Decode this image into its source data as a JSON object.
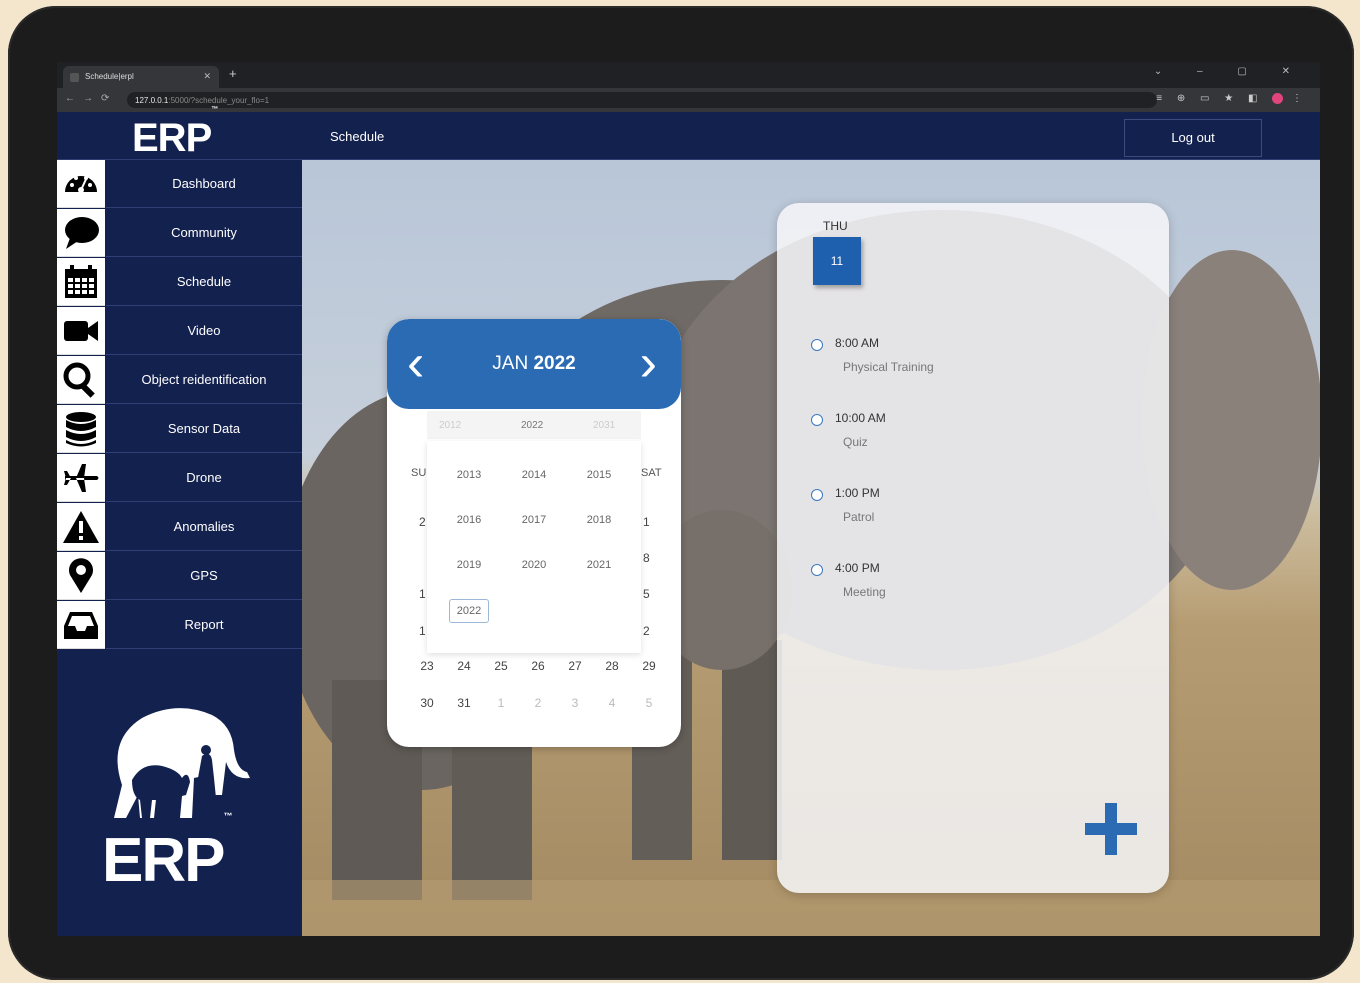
{
  "browser": {
    "tab_title": "Schedule|erpl",
    "url_host": "127.0.0.1",
    "url_rest": ":5000/?schedule_your_flo=1"
  },
  "header": {
    "logo": "ERP",
    "logo_tm": "™",
    "title": "Schedule",
    "logout_label": "Log out"
  },
  "sidebar": {
    "items": [
      {
        "label": "Dashboard",
        "icon": "dashboard-icon"
      },
      {
        "label": "Community",
        "icon": "chat-bubble-icon"
      },
      {
        "label": "Schedule",
        "icon": "calendar-icon"
      },
      {
        "label": "Video",
        "icon": "video-camera-icon"
      },
      {
        "label": "Object reidentification",
        "icon": "search-icon"
      },
      {
        "label": "Sensor Data",
        "icon": "database-icon"
      },
      {
        "label": "Drone",
        "icon": "airplane-icon"
      },
      {
        "label": "Anomalies",
        "icon": "warning-icon"
      },
      {
        "label": "GPS",
        "icon": "map-pin-icon"
      },
      {
        "label": "Report",
        "icon": "inbox-icon"
      }
    ],
    "bottom_logo": "ERP",
    "bottom_logo_tm": "™"
  },
  "calendar": {
    "month": "JAN",
    "year": "2022",
    "yearbar_left": "2012",
    "yearbar_center": "2022",
    "yearbar_right": "2031",
    "day_header_left": "SU",
    "day_header_right": "SAT",
    "years": [
      "2013",
      "2014",
      "2015",
      "2016",
      "2017",
      "2018",
      "2019",
      "2020",
      "2021",
      "2022"
    ],
    "selected_year": "2022",
    "left_col": [
      "2",
      "1",
      "1"
    ],
    "right_col": [
      "1",
      "8",
      "5",
      "2"
    ],
    "row5": [
      "23",
      "24",
      "25",
      "26",
      "27",
      "28",
      "29"
    ],
    "row6": [
      "30",
      "31",
      "1",
      "2",
      "3",
      "4",
      "5"
    ]
  },
  "schedule": {
    "day_of_week": "THU",
    "day": "11",
    "events": [
      {
        "time": "8:00 AM",
        "name": "Physical Training"
      },
      {
        "time": "10:00 AM",
        "name": "Quiz"
      },
      {
        "time": "1:00 PM",
        "name": "Patrol"
      },
      {
        "time": "4:00 PM",
        "name": "Meeting"
      }
    ]
  },
  "colors": {
    "navy": "#13214f",
    "accent": "#2a6bb4"
  }
}
